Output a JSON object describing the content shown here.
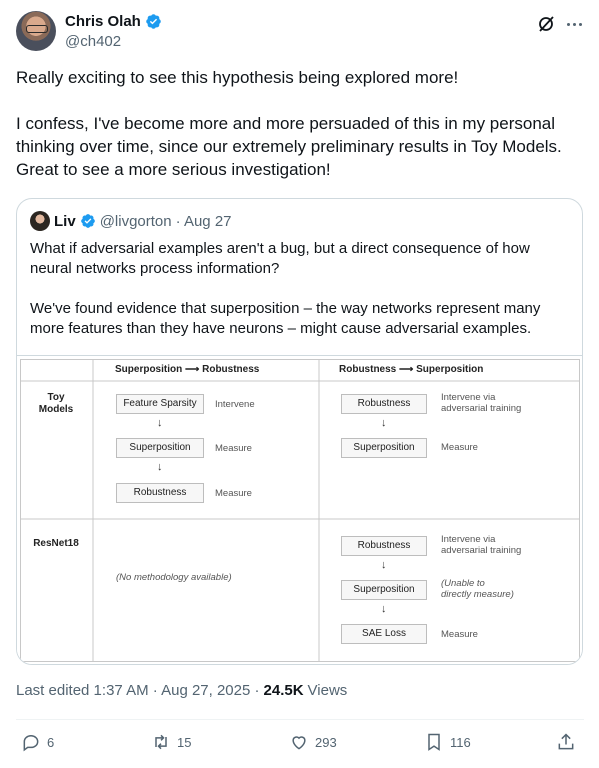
{
  "author": {
    "name": "Chris Olah",
    "handle": "@ch402"
  },
  "tweet": {
    "paragraphs": [
      "Really exciting to see this hypothesis being explored more!",
      "I confess, I've become more and more persuaded of this  in my personal thinking over time, since our extremely preliminary results in Toy Models. Great to see a more serious investigation!"
    ]
  },
  "quote": {
    "name": "Liv",
    "handle": "@livgorton",
    "date": "· Aug 27",
    "paragraphs": [
      "What if adversarial examples aren't a bug, but a direct consequence of how neural networks process information?",
      "We've found evidence that superposition – the way networks represent many more features than they have neurons – might cause adversarial examples."
    ],
    "diagram": {
      "col_left_header": "Superposition ⟶ Robustness",
      "col_right_header": "Robustness ⟶ Superposition",
      "row1_label": "Toy\nModels",
      "row2_label": "ResNet18",
      "toy_left": {
        "box1": "Feature Sparsity",
        "note1": "Intervene",
        "box2": "Superposition",
        "note2": "Measure",
        "box3": "Robustness",
        "note3": "Measure"
      },
      "toy_right": {
        "box1": "Robustness",
        "note1": "Intervene via\nadversarial training",
        "box2": "Superposition",
        "note2": "Measure"
      },
      "resnet_left_note": "(No methodology available)",
      "resnet_right": {
        "box1": "Robustness",
        "note1": "Intervene via\nadversarial training",
        "box2": "Superposition",
        "note2": "(Unable to\ndirectly measure)",
        "box3": "SAE Loss",
        "note3": "Measure"
      },
      "arrow": "↓"
    }
  },
  "meta": {
    "edited": "Last edited 1:37 AM · Aug 27, 2025 ·",
    "views_count": "24.5K",
    "views_label": "Views"
  },
  "actions": {
    "replies": "6",
    "reposts": "15",
    "likes": "293",
    "bookmarks": "116"
  },
  "colors": {
    "verified": "#1d9bf0",
    "secondary_text": "#536471"
  }
}
